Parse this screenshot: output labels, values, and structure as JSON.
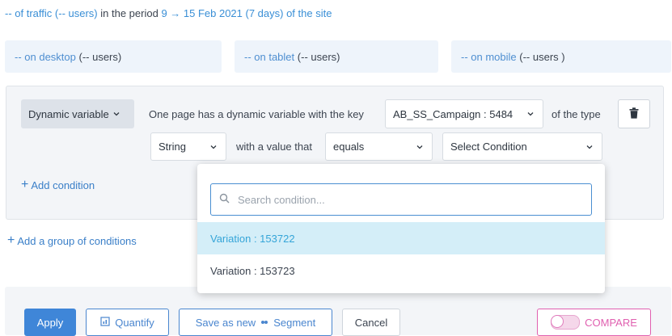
{
  "summary": {
    "prefix": "-- of traffic",
    "users": "(-- users)",
    "middle": "in the period",
    "period": "9 → 15 Feb 2021 (7 days) of the site"
  },
  "devices": [
    {
      "name": "-- on desktop",
      "users": "(-- users)"
    },
    {
      "name": "-- on tablet",
      "users": "(-- users)"
    },
    {
      "name": "-- on mobile",
      "users": "(-- users )"
    }
  ],
  "condition": {
    "type_button": "Dynamic variable",
    "sentence_1": "One page has a dynamic variable with the key",
    "key_select": "AB_SS_Campaign : 5484",
    "sentence_2": "of the type",
    "type_select": "String",
    "sentence_3": "with a value that",
    "operator_select": "equals",
    "value_select": "Select Condition",
    "add_condition": "Add condition",
    "add_group": "Add a group of conditions"
  },
  "dropdown": {
    "search_placeholder": "Search condition...",
    "options": [
      {
        "label": "Variation : 153722",
        "selected": true
      },
      {
        "label": "Variation : 153723",
        "selected": false
      }
    ]
  },
  "footer": {
    "apply": "Apply",
    "quantify": "Quantify",
    "save_segment": "Save as new",
    "segment_word": "Segment",
    "cancel": "Cancel",
    "compare": "COMPARE"
  },
  "colors": {
    "accent": "#3a8fd6",
    "selected_bg": "#d4eef8",
    "compare": "#e060b0"
  }
}
